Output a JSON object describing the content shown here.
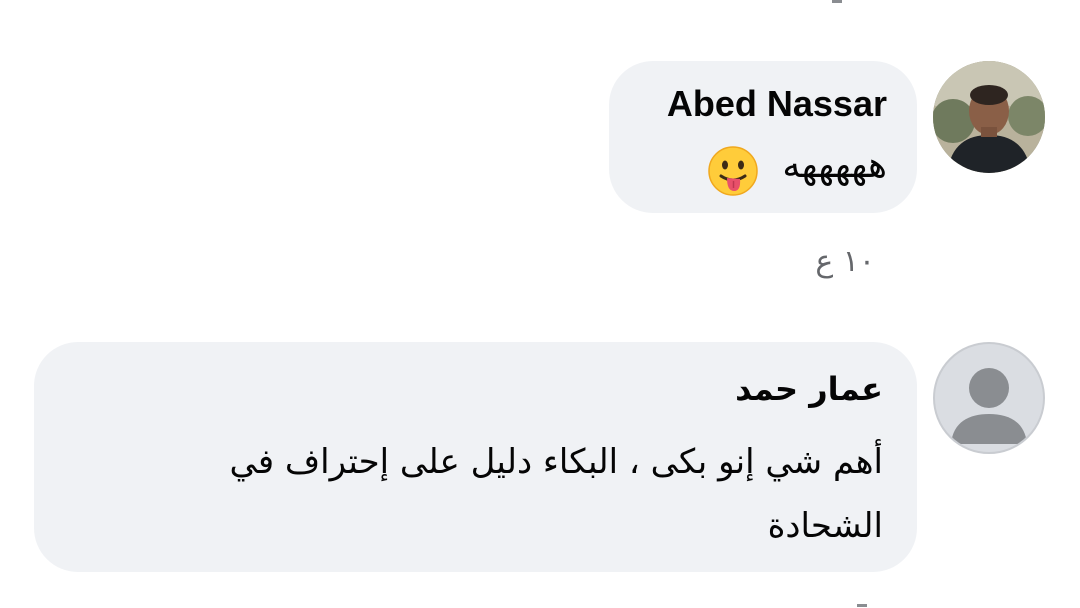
{
  "comments": [
    {
      "author": "Abed Nassar",
      "text": "هههههه",
      "emoji": "😛",
      "emoji_name": "face-with-tongue-icon",
      "timestamp": "١٠ ع",
      "avatar": "profile-photo"
    },
    {
      "author": "عمار حمد",
      "text": "أهم شي إنو بكى ، البكاء دليل على إحتراف في الشحادة",
      "avatar": "default-avatar"
    }
  ],
  "colors": {
    "bubble": "#f0f2f5",
    "text": "#050505",
    "meta": "#65676b",
    "background": "#ffffff"
  }
}
